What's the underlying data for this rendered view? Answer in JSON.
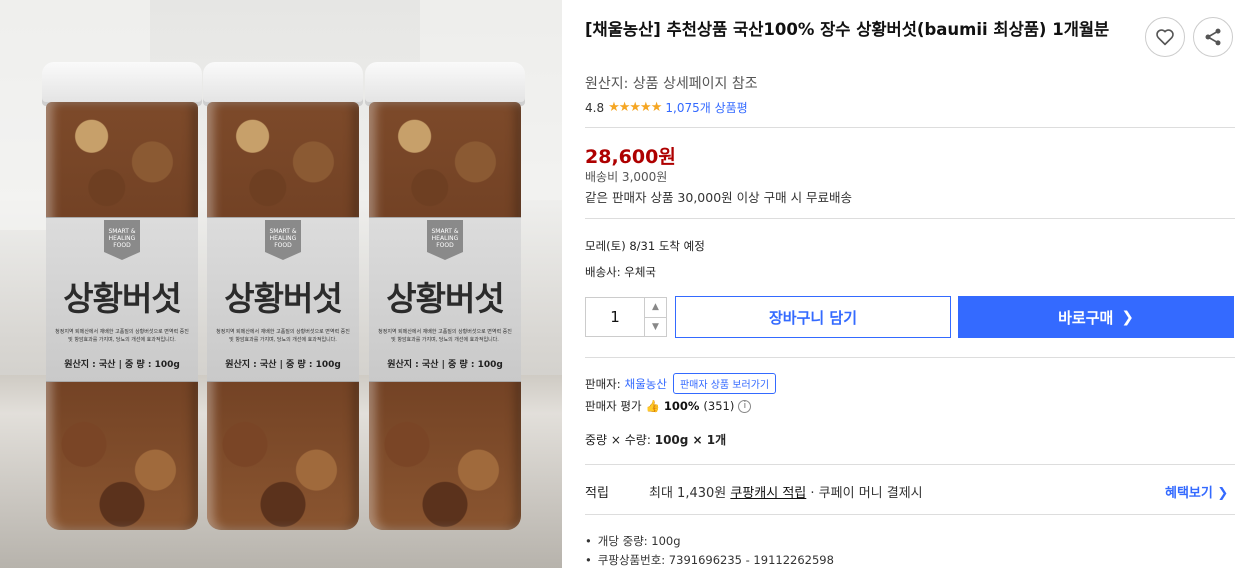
{
  "product": {
    "title": "[채울농산] 추천상품 국산100% 장수 상황버섯(baumii 최상품) 1개월분",
    "origin": "원산지: 상품 상세페이지 참조",
    "rating_value": "4.8",
    "stars": "★★★★★",
    "review_count": "1,075개 상품평"
  },
  "image": {
    "jar_title": "상황버섯",
    "badge_text": "SMART & HEALING FOOD",
    "jar_desc": "청정지역 퇴메산에서 재배한 고품질의 상황버섯으로 면역력 증진 및 항암효과를 가지며, 당뇨의 개선에 효과적입니다.",
    "jar_info": "원산지 : 국산 | 중 량 : 100g"
  },
  "price": {
    "amount": "28,600원",
    "shipping_fee": "배송비 3,000원",
    "free_shipping": "같은 판매자 상품 30,000원 이상 구매 시 무료배송",
    "color": "#ae0000"
  },
  "delivery": {
    "arrival": "모레(토) 8/31 도착 예정",
    "carrier": "배송사: 우체국"
  },
  "purchase": {
    "quantity": "1",
    "cart_label": "장바구니 담기",
    "buy_label": "바로구매",
    "accent": "#346aff"
  },
  "seller": {
    "label": "판매자:",
    "name": "채울농산",
    "tooltip": "판매자 상품 보러가기",
    "rating_label": "판매자 평가",
    "rating_percent": "100%",
    "rating_count": "(351)"
  },
  "option": {
    "label": "중량 × 수량:",
    "value": "100g × 1개"
  },
  "reward": {
    "label": "적립",
    "prefix": "최대 1,430원",
    "link": "쿠팡캐시 적립",
    "suffix": "· 쿠페이 머니 결제시",
    "benefit_label": "혜택보기"
  },
  "details": [
    "개당 중량: 100g",
    "쿠팡상품번호: 7391696235 - 19112262598"
  ]
}
